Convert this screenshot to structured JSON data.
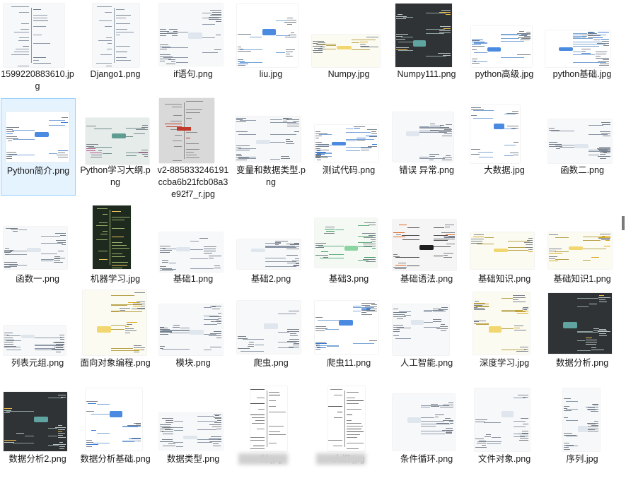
{
  "files": [
    {
      "name": "1599220883610.jpg",
      "style": "tall",
      "theme": "light"
    },
    {
      "name": "Django1.png",
      "style": "tall",
      "theme": "light"
    },
    {
      "name": "if语句.png",
      "style": "mind",
      "theme": "light"
    },
    {
      "name": "liu.jpg",
      "style": "mind",
      "theme": "blue"
    },
    {
      "name": "Numpy.jpg",
      "style": "mind",
      "theme": "yellow"
    },
    {
      "name": "Numpy111.png",
      "style": "mind",
      "theme": "dark"
    },
    {
      "name": "python高级.jpg",
      "style": "mind",
      "theme": "blue"
    },
    {
      "name": "python基础.jpg",
      "style": "mind",
      "theme": "blue"
    },
    {
      "name": "Python简介.png",
      "style": "mind",
      "theme": "blue",
      "selected": true
    },
    {
      "name": "Python学习大纲.png",
      "style": "mind",
      "theme": "colorful"
    },
    {
      "name": "v2-885833246191ccba6b21fcb08a3e92f7_r.jpg",
      "style": "tall",
      "theme": "grey"
    },
    {
      "name": "变量和数据类型.png",
      "style": "mind",
      "theme": "light"
    },
    {
      "name": "测试代码.png",
      "style": "mind",
      "theme": "blue"
    },
    {
      "name": "错误 异常.png",
      "style": "mind",
      "theme": "light"
    },
    {
      "name": "大数据.jpg",
      "style": "mind",
      "theme": "blue"
    },
    {
      "name": "函数二.png",
      "style": "mind",
      "theme": "light"
    },
    {
      "name": "函数一.png",
      "style": "mind",
      "theme": "light"
    },
    {
      "name": "机器学习.jpg",
      "style": "tall",
      "theme": "darkgreen"
    },
    {
      "name": "基础1.png",
      "style": "mind",
      "theme": "light"
    },
    {
      "name": "基础2.png",
      "style": "mind",
      "theme": "light"
    },
    {
      "name": "基础3.png",
      "style": "mind",
      "theme": "green"
    },
    {
      "name": "基础语法.png",
      "style": "mind",
      "theme": "orange"
    },
    {
      "name": "基础知识.png",
      "style": "mind",
      "theme": "yellow"
    },
    {
      "name": "基础知识1.png",
      "style": "mind",
      "theme": "yellow"
    },
    {
      "name": "列表元组.png",
      "style": "mind",
      "theme": "light"
    },
    {
      "name": "面向对象编程.png",
      "style": "mind",
      "theme": "yellow"
    },
    {
      "name": "模块.png",
      "style": "mind",
      "theme": "light"
    },
    {
      "name": "爬虫.png",
      "style": "mind",
      "theme": "light"
    },
    {
      "name": "爬虫11.png",
      "style": "mind",
      "theme": "blue"
    },
    {
      "name": "人工智能.png",
      "style": "mind",
      "theme": "light"
    },
    {
      "name": "深度学习.jpg",
      "style": "mind",
      "theme": "yellow"
    },
    {
      "name": "数据分析.png",
      "style": "mind",
      "theme": "dark"
    },
    {
      "name": "数据分析2.png",
      "style": "mind",
      "theme": "dark"
    },
    {
      "name": "数据分析基础.png",
      "style": "mind",
      "theme": "blue"
    },
    {
      "name": "数据类型.png",
      "style": "mind",
      "theme": "light"
    },
    {
      "name": "刹.jpg",
      "style": "tall",
      "theme": "white",
      "blurred": true
    },
    {
      "name": "大纲.jpg",
      "style": "tall",
      "theme": "white",
      "blurred": true
    },
    {
      "name": "条件循环.png",
      "style": "mind",
      "theme": "light"
    },
    {
      "name": "文件对象.png",
      "style": "mind",
      "theme": "light"
    },
    {
      "name": "序列.jpg",
      "style": "mind",
      "theme": "light"
    }
  ],
  "colors": {
    "selected_bg": "#e5f3ff",
    "selected_border": "#99d1ff",
    "text": "#1a1a1a",
    "scrollbar_thumb": "#7a7a7a"
  }
}
